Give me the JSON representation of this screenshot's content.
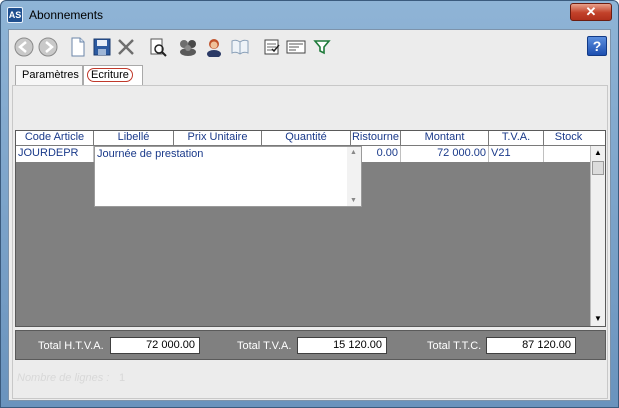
{
  "window": {
    "title": "Abonnements",
    "close_label": "✕"
  },
  "toolbar": {
    "help_label": "?",
    "buttons": [
      {
        "name": "back-icon"
      },
      {
        "name": "forward-icon"
      },
      {
        "name": "new-document-icon"
      },
      {
        "name": "save-icon"
      },
      {
        "name": "delete-icon"
      },
      {
        "name": "search-document-icon"
      },
      {
        "name": "users-group-icon"
      },
      {
        "name": "user-icon"
      },
      {
        "name": "book-icon"
      },
      {
        "name": "checklist-icon"
      },
      {
        "name": "card-icon"
      },
      {
        "name": "filter-icon"
      }
    ]
  },
  "tabs": [
    {
      "label": "Paramètres",
      "active": false
    },
    {
      "label": "Ecriture",
      "active": true
    }
  ],
  "grid": {
    "columns": [
      "Code Article",
      "Libellé",
      "Prix Unitaire",
      "Quantité",
      "Ristourne",
      "Montant",
      "T.V.A.",
      "Stock"
    ],
    "rows": [
      {
        "code": "JOURDEPR",
        "libelle": "Journée de prestation",
        "prix": "",
        "quantite": "",
        "ristourne": "0.00",
        "montant": "72 000.00",
        "tva": "V21",
        "stock": ""
      }
    ]
  },
  "totals": {
    "htva_label": "Total H.T.V.A.",
    "htva_value": "72 000.00",
    "tva_label": "Total T.V.A.",
    "tva_value": "15 120.00",
    "ttc_label": "Total T.T.C.",
    "ttc_value": "87 120.00"
  },
  "footer": {
    "line_count_label": "Nombre de lignes :",
    "line_count_value": "1"
  },
  "colors": {
    "title_bar": "#8fb4d6",
    "grid_background": "#808080",
    "header_text": "#1a3a8a",
    "close_button": "#c2412a"
  }
}
